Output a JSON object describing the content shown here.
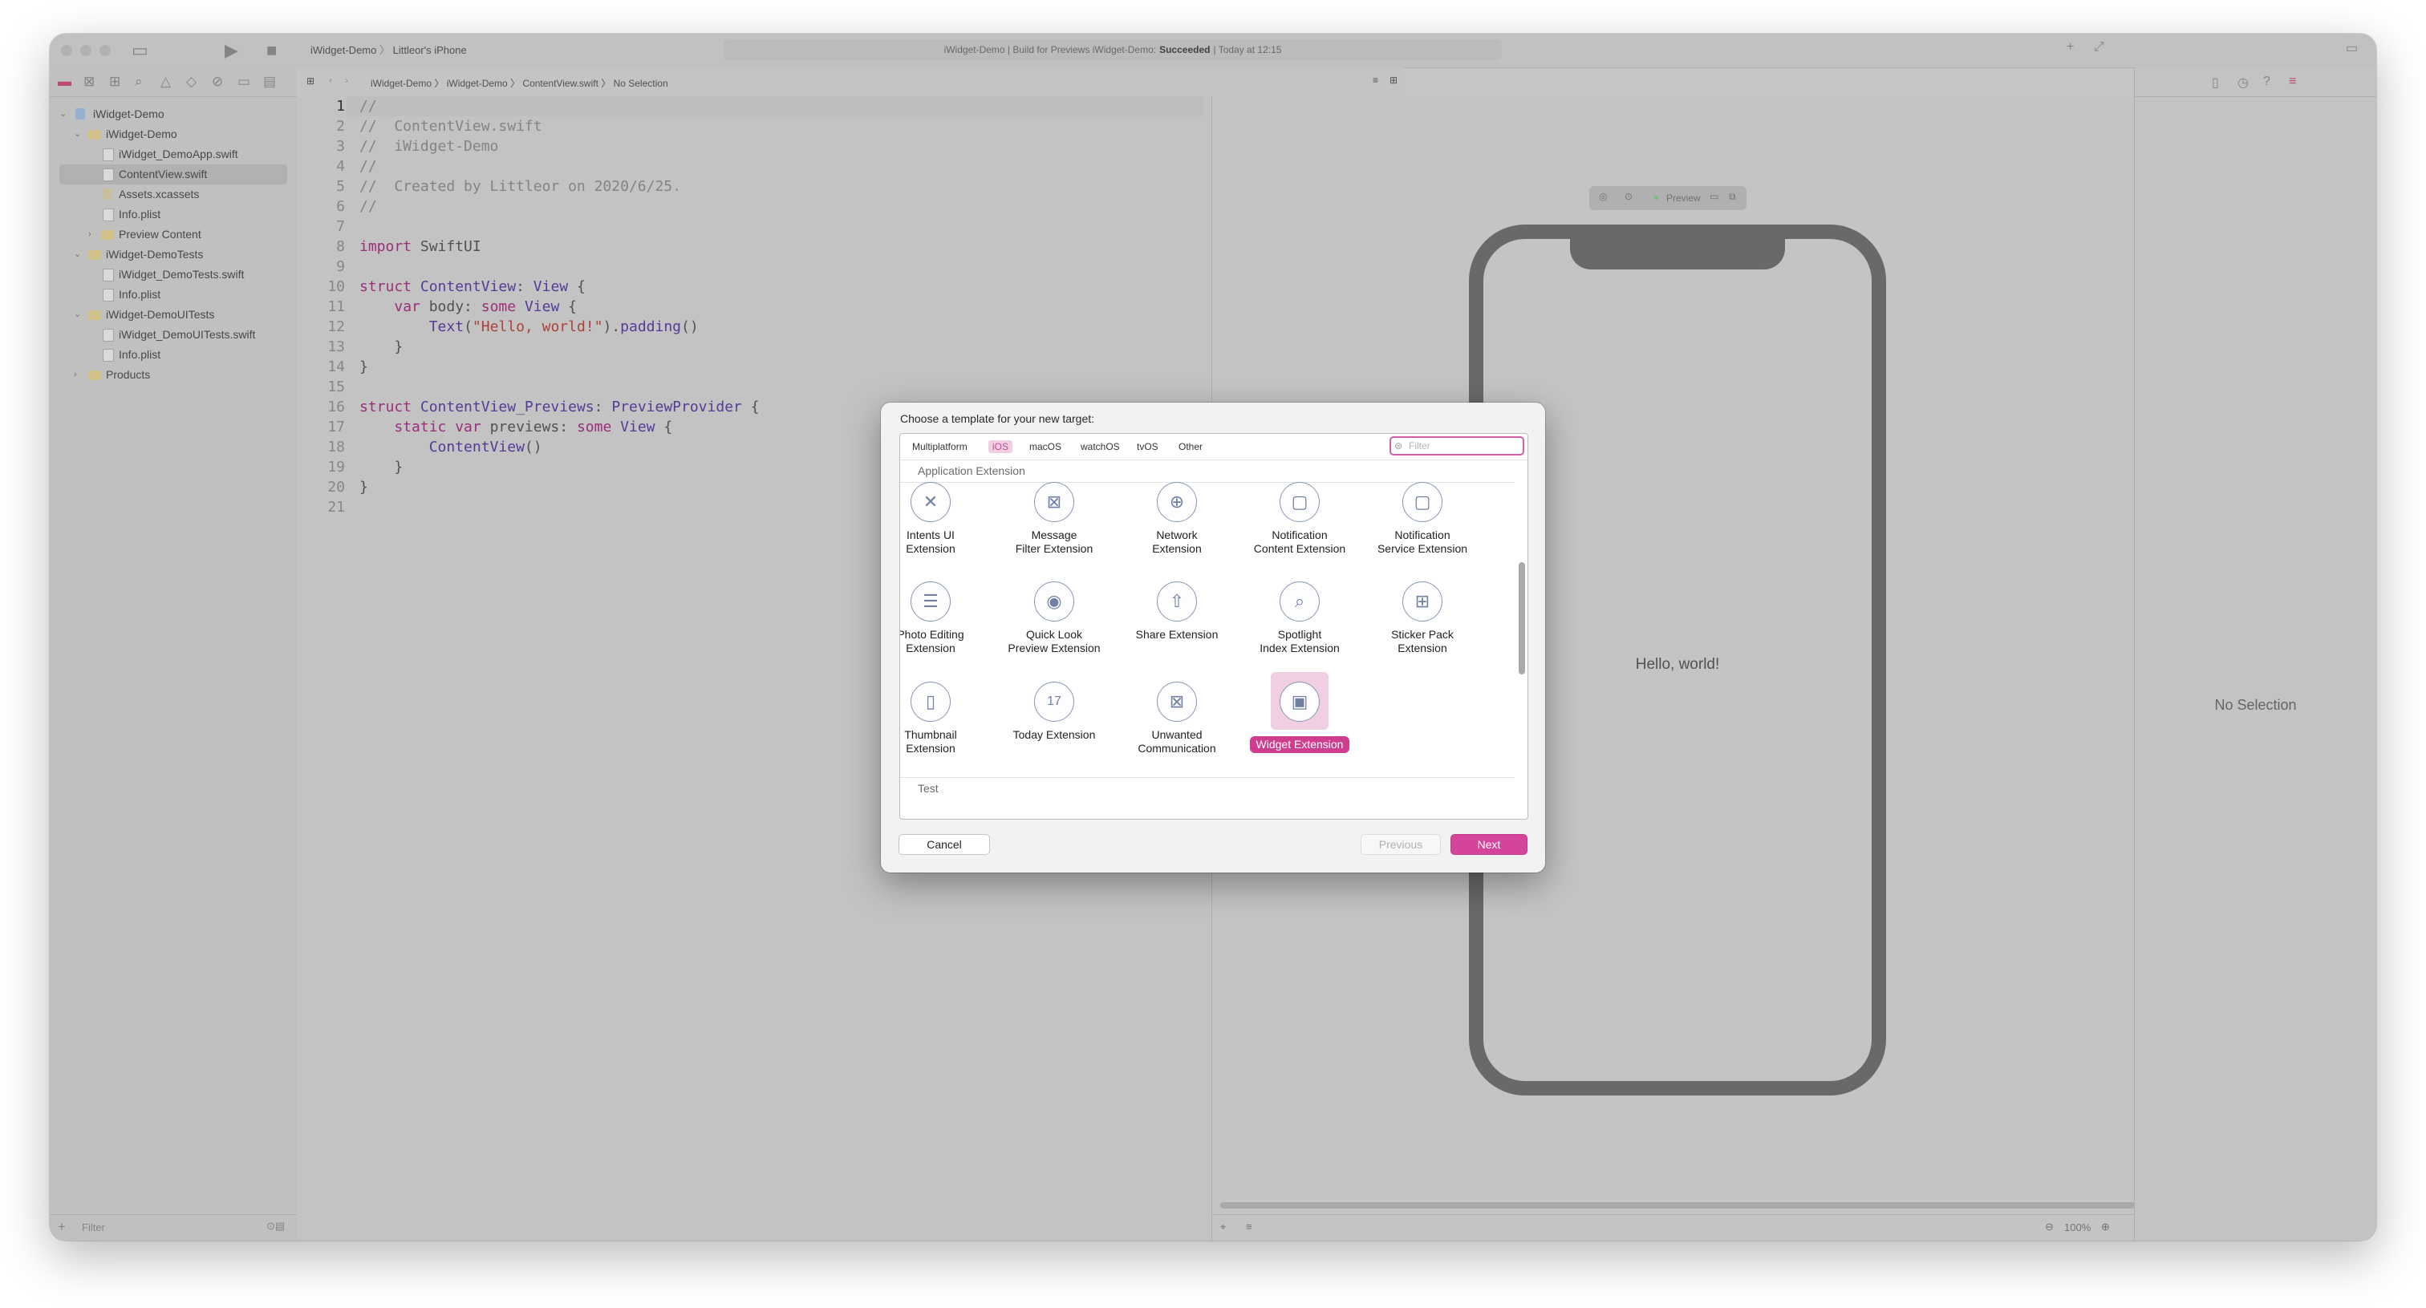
{
  "toolbar": {
    "scheme_project": "iWidget-Demo",
    "scheme_device": "Littleor's iPhone",
    "status_prefix": "iWidget-Demo | Build for Previews iWidget-Demo:",
    "status_result": "Succeeded",
    "status_suffix": "| Today at 12:15"
  },
  "jumpbar": {
    "crumbs": [
      "iWidget-Demo",
      "iWidget-Demo",
      "ContentView.swift",
      "No Selection"
    ]
  },
  "navigator": {
    "items": [
      {
        "label": "iWidget-Demo"
      },
      {
        "label": "iWidget-Demo"
      },
      {
        "label": "iWidget_DemoApp.swift"
      },
      {
        "label": "ContentView.swift"
      },
      {
        "label": "Assets.xcassets"
      },
      {
        "label": "Info.plist"
      },
      {
        "label": "Preview Content"
      },
      {
        "label": "iWidget-DemoTests"
      },
      {
        "label": "iWidget_DemoTests.swift"
      },
      {
        "label": "Info.plist"
      },
      {
        "label": "iWidget-DemoUITests"
      },
      {
        "label": "iWidget_DemoUITests.swift"
      },
      {
        "label": "Info.plist"
      },
      {
        "label": "Products"
      }
    ],
    "filter_placeholder": "Filter"
  },
  "editor": {
    "line_numbers": [
      "1",
      "2",
      "3",
      "4",
      "5",
      "6",
      "7",
      "8",
      "9",
      "10",
      "11",
      "12",
      "13",
      "14",
      "15",
      "16",
      "17",
      "18",
      "19",
      "20",
      "21"
    ]
  },
  "canvas": {
    "preview_label": "Preview",
    "hello_text": "Hello, world!",
    "zoom": "100%"
  },
  "inspector": {
    "no_selection": "No Selection"
  },
  "dialog": {
    "title": "Choose a template for your new target:",
    "platform_tabs": [
      "Multiplatform",
      "iOS",
      "macOS",
      "watchOS",
      "tvOS",
      "Other"
    ],
    "active_platform": "iOS",
    "filter_placeholder": "Filter",
    "section_application_extension": "Application Extension",
    "section_test": "Test",
    "templates": [
      {
        "line1": "Intents UI",
        "line2": "Extension",
        "icon": "intents-ui-icon"
      },
      {
        "line1": "Message",
        "line2": "Filter Extension",
        "icon": "message-filter-icon"
      },
      {
        "line1": "Network",
        "line2": "Extension",
        "icon": "network-globe-icon"
      },
      {
        "line1": "Notification",
        "line2": "Content Extension",
        "icon": "notification-content-icon"
      },
      {
        "line1": "Notification",
        "line2": "Service Extension",
        "icon": "notification-service-icon"
      },
      {
        "line1": "Photo Editing",
        "line2": "Extension",
        "icon": "photo-editing-sliders-icon"
      },
      {
        "line1": "Quick Look",
        "line2": "Preview Extension",
        "icon": "quick-look-eye-icon"
      },
      {
        "line1": "Share Extension",
        "line2": "",
        "icon": "share-icon"
      },
      {
        "line1": "Spotlight",
        "line2": "Index Extension",
        "icon": "spotlight-magnifier-icon"
      },
      {
        "line1": "Sticker Pack",
        "line2": "Extension",
        "icon": "sticker-pack-grid-icon"
      },
      {
        "line1": "Thumbnail",
        "line2": "Extension",
        "icon": "thumbnail-icon"
      },
      {
        "line1": "Today Extension",
        "line2": "",
        "icon": "today-calendar-icon"
      },
      {
        "line1": "Unwanted",
        "line2": "Communication",
        "icon": "unwanted-communication-icon"
      },
      {
        "line1": "Widget Extension",
        "line2": "",
        "icon": "widget-icon",
        "selected": true
      }
    ],
    "cancel_label": "Cancel",
    "previous_label": "Previous",
    "next_label": "Next"
  },
  "colors": {
    "accent": "#d3449a",
    "accent_light": "#f1cfe2",
    "keyword": "#a2307f",
    "type": "#5a3d9e",
    "string": "#b2453b"
  }
}
